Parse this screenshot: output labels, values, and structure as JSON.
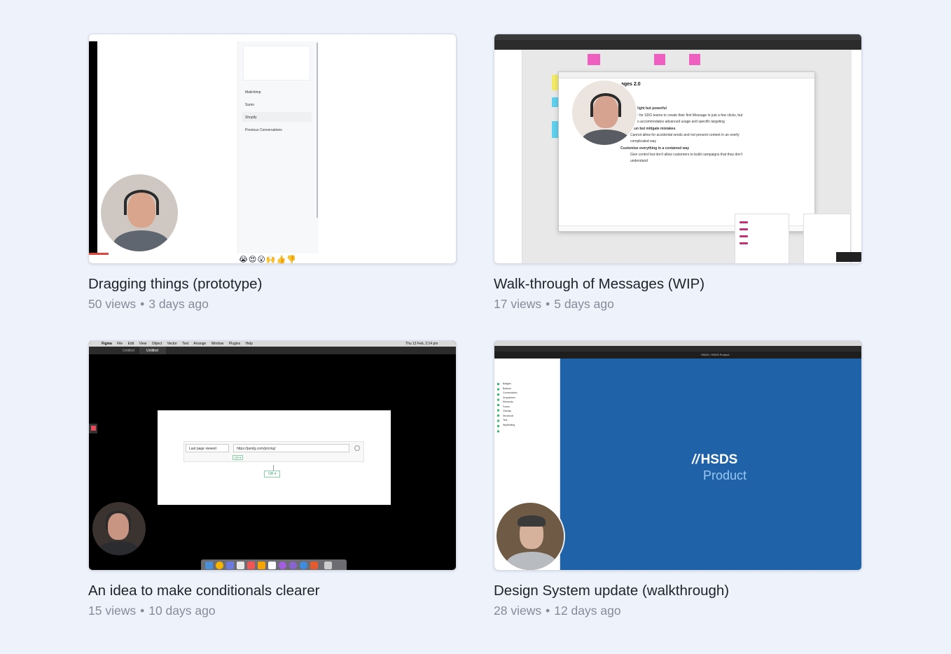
{
  "videos": [
    {
      "title": "Dragging things (prototype)",
      "views": "50 views",
      "age": "3 days ago",
      "menu_items": [
        "Mailchimp",
        "Sumo",
        "Shopify",
        "Previous Conversations"
      ],
      "reactions": "😭😍😮🙌👍👎"
    },
    {
      "title": "Walk-through of Messages (WIP)",
      "views": "17 views",
      "age": "5 days ago",
      "doc_heading": "ages 2.0",
      "doc_lines": [
        "light but powerful",
        "r for SDG teams to create their first Message in just a few clicks, but",
        "o accommodates advanced usage and specific targeting",
        "e fun but mitigate mistakes",
        "Cannot allow for accidental sends and not present content in an overly",
        "complicated way",
        "Customise everything in a contained way",
        "Give control but don't allow customers to build campaigns that they don't",
        "understand"
      ]
    },
    {
      "title": "An idea to make conditionals clearer",
      "views": "15 views",
      "age": "10 days ago",
      "menubar": [
        "Figma",
        "File",
        "Edit",
        "View",
        "Object",
        "Vector",
        "Text",
        "Arrange",
        "Window",
        "Plugins",
        "Help"
      ],
      "clock": "Thu 13 Feb, 2:14 pm",
      "tab": "Untitled",
      "select_value": "Last page viewed",
      "url_value": "https://jandg.com/pricing/",
      "or_small": "OR ▾",
      "or_button": "OR ▾"
    },
    {
      "title": "Design System update (walkthrough)",
      "views": "28 views",
      "age": "12 days ago",
      "logo_top": "HSDS",
      "logo_bottom": "Product",
      "breadcrumb": "HSDS / HSDS Product",
      "layers": [
        "Badges",
        "Buttons",
        "Conversation",
        "Dropdowns",
        "Elements",
        "Forms",
        "Overlay",
        "Structural",
        "Text",
        "Wayfinding"
      ]
    }
  ],
  "separator": "•"
}
